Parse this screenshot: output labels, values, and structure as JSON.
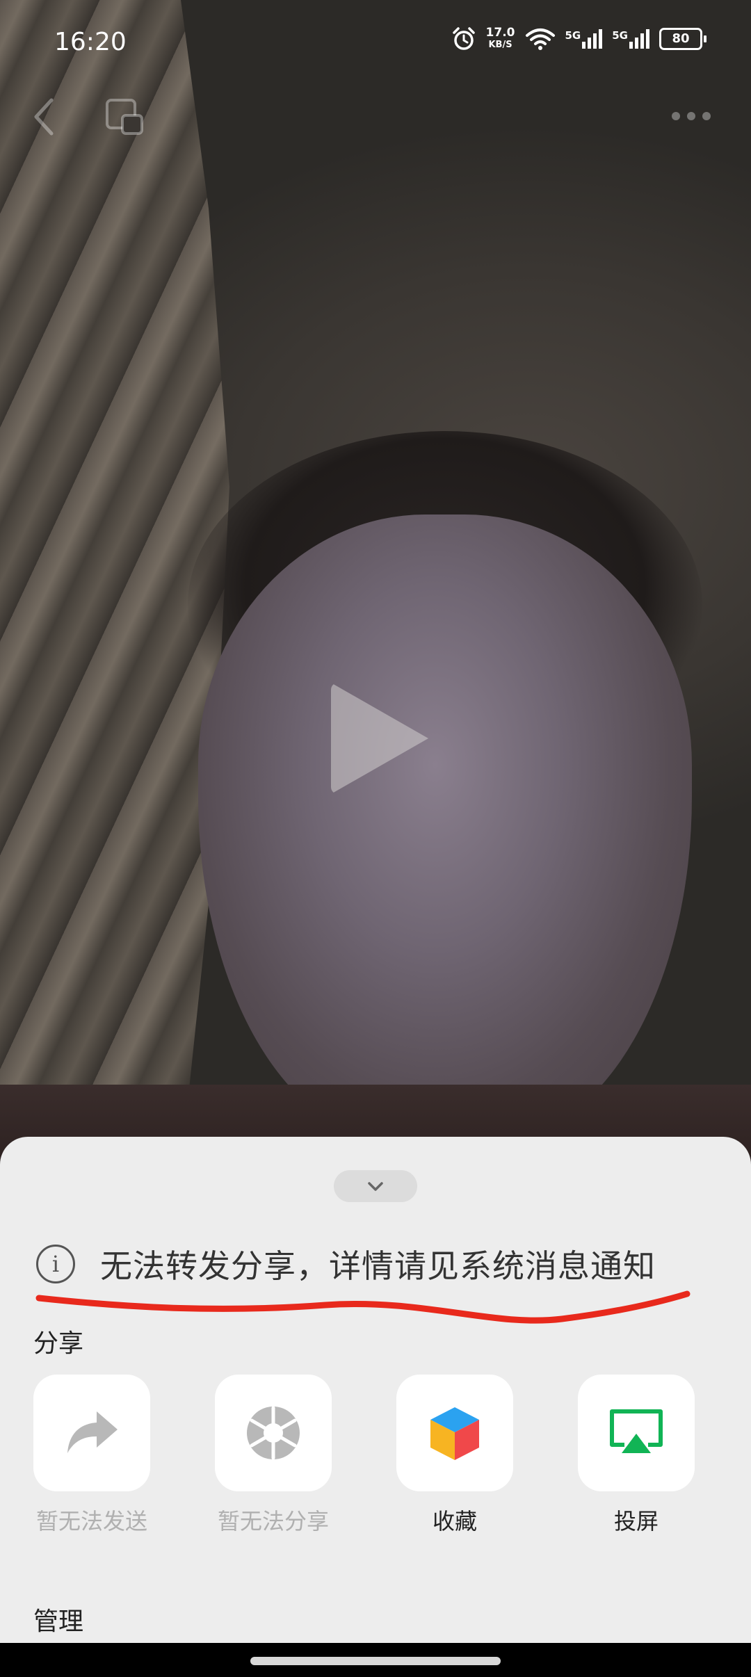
{
  "status_bar": {
    "time": "16:20",
    "speed_value": "17.0",
    "speed_unit": "KB/S",
    "network_1": "5G",
    "network_2": "5G",
    "battery": "80"
  },
  "video": {
    "state": "paused"
  },
  "sheet": {
    "notice": "无法转发分享，详情请见系统消息通知",
    "share_section_title": "分享",
    "share_items": [
      {
        "label": "暂无法发送",
        "icon": "forward-arrow-icon",
        "enabled": false
      },
      {
        "label": "暂无法分享",
        "icon": "aperture-share-icon",
        "enabled": false
      },
      {
        "label": "收藏",
        "icon": "favorite-cube-icon",
        "enabled": true
      },
      {
        "label": "投屏",
        "icon": "screen-cast-icon",
        "enabled": true
      }
    ],
    "manage_section_title": "管理"
  },
  "colors": {
    "sheet_bg": "#ededed",
    "annotation_red": "#e8291c",
    "cast_green": "#11b455"
  }
}
